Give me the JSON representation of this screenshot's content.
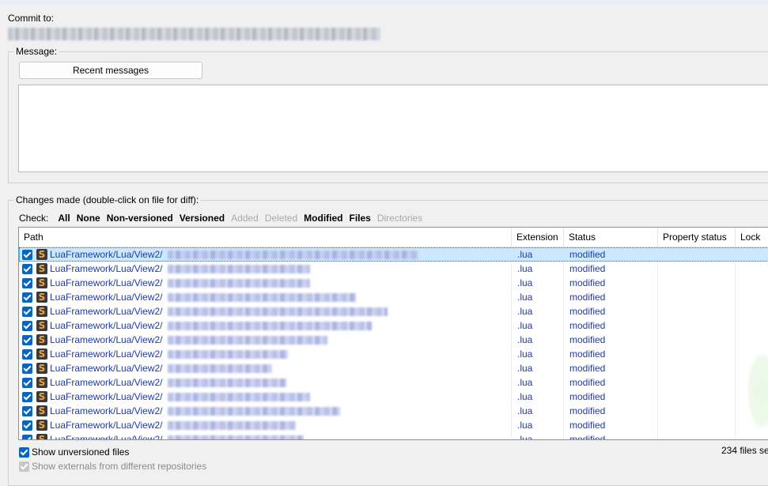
{
  "commit": {
    "label": "Commit to:"
  },
  "message": {
    "group_title": "Message:",
    "recent_button": "Recent messages",
    "text": ""
  },
  "changes": {
    "group_title": "Changes made (double-click on file for diff):",
    "check_label": "Check:",
    "check_options": [
      {
        "label": "All",
        "enabled": true
      },
      {
        "label": "None",
        "enabled": true
      },
      {
        "label": "Non-versioned",
        "enabled": true
      },
      {
        "label": "Versioned",
        "enabled": true
      },
      {
        "label": "Added",
        "enabled": false
      },
      {
        "label": "Deleted",
        "enabled": false
      },
      {
        "label": "Modified",
        "enabled": true
      },
      {
        "label": "Files",
        "enabled": true
      },
      {
        "label": "Directories",
        "enabled": false
      }
    ],
    "columns": {
      "path": "Path",
      "extension": "Extension",
      "status": "Status",
      "property_status": "Property status",
      "lock": "Lock"
    },
    "rows": [
      {
        "path": "LuaFramework/Lua/View2/",
        "extension": ".lua",
        "status": "modified",
        "checked": true,
        "selected": true
      },
      {
        "path": "LuaFramework/Lua/View2/",
        "extension": ".lua",
        "status": "modified",
        "checked": true,
        "selected": false
      },
      {
        "path": "LuaFramework/Lua/View2/",
        "extension": ".lua",
        "status": "modified",
        "checked": true,
        "selected": false
      },
      {
        "path": "LuaFramework/Lua/View2/",
        "extension": ".lua",
        "status": "modified",
        "checked": true,
        "selected": false
      },
      {
        "path": "LuaFramework/Lua/View2/",
        "extension": ".lua",
        "status": "modified",
        "checked": true,
        "selected": false
      },
      {
        "path": "LuaFramework/Lua/View2/",
        "extension": ".lua",
        "status": "modified",
        "checked": true,
        "selected": false
      },
      {
        "path": "LuaFramework/Lua/View2/",
        "extension": ".lua",
        "status": "modified",
        "checked": true,
        "selected": false
      },
      {
        "path": "LuaFramework/Lua/View2/",
        "extension": ".lua",
        "status": "modified",
        "checked": true,
        "selected": false
      },
      {
        "path": "LuaFramework/Lua/View2/",
        "extension": ".lua",
        "status": "modified",
        "checked": true,
        "selected": false
      },
      {
        "path": "LuaFramework/Lua/View2/",
        "extension": ".lua",
        "status": "modified",
        "checked": true,
        "selected": false
      },
      {
        "path": "LuaFramework/Lua/View2/",
        "extension": ".lua",
        "status": "modified",
        "checked": true,
        "selected": false
      },
      {
        "path": "LuaFramework/Lua/View2/",
        "extension": ".lua",
        "status": "modified",
        "checked": true,
        "selected": false
      },
      {
        "path": "LuaFramework/Lua/View2/",
        "extension": ".lua",
        "status": "modified",
        "checked": true,
        "selected": false
      },
      {
        "path": "LuaFramework/Lua/View2/",
        "extension": ".lua",
        "status": "modified",
        "checked": true,
        "selected": false
      }
    ],
    "file_icon": "sublime-text-icon",
    "link_color": "#1f3aa8",
    "selection_color": "#cce8ff"
  },
  "options": {
    "show_unversioned": {
      "label": "Show unversioned files",
      "checked": true,
      "enabled": true
    },
    "show_externals": {
      "label": "Show externals from different repositories",
      "checked": true,
      "enabled": false
    }
  },
  "status_bar": {
    "files_selected": "234 files se"
  }
}
